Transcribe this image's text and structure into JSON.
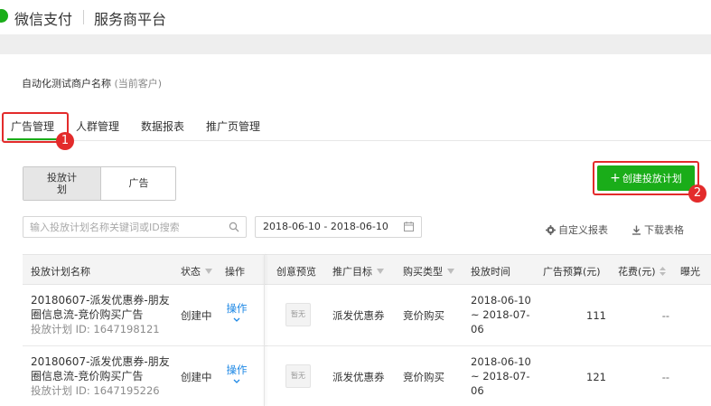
{
  "header": {
    "brand": "微信支付",
    "platform": "服务商平台"
  },
  "merchant": {
    "name": "自动化测试商户名称",
    "sub": "(当前客户)"
  },
  "tabs": [
    {
      "label": "广告管理",
      "active": true
    },
    {
      "label": "人群管理",
      "active": false
    },
    {
      "label": "数据报表",
      "active": false
    },
    {
      "label": "推广页管理",
      "active": false
    }
  ],
  "toggle": {
    "plan_line1": "投放计",
    "plan_line2": "划",
    "ad": "广告"
  },
  "create_button": {
    "label": "创建投放计划"
  },
  "callouts": {
    "one": "1",
    "two": "2"
  },
  "search": {
    "placeholder": "输入投放计划名称关键词或ID搜索"
  },
  "date_range": "2018-06-10 - 2018-06-10",
  "tools": {
    "custom_report": "自定义报表",
    "download": "下载表格"
  },
  "table": {
    "columns": {
      "name": "投放计划名称",
      "status": "状态",
      "op": "操作",
      "preview": "创意预览",
      "target": "推广目标",
      "buy_type": "购买类型",
      "time": "投放时间",
      "budget": "广告预算(元)",
      "spend": "花费(元)",
      "expo": "曝光"
    },
    "rows": [
      {
        "name_line1": "20180607-派发优惠券-朋友",
        "name_line2": "圈信息流-竞价购买广告",
        "plan_id": "投放计划 ID: 1647198121",
        "status": "创建中",
        "op": "操作",
        "preview": "暂无",
        "target": "派发优惠券",
        "buy_type": "竞价购买",
        "time_line1": "2018-06-10",
        "time_line2": "~ 2018-07-",
        "time_line3": "06",
        "budget": "111",
        "spend": "--"
      },
      {
        "name_line1": "20180607-派发优惠券-朋友",
        "name_line2": "圈信息流-竞价购买广告",
        "plan_id": "投放计划 ID: 1647195226",
        "status": "创建中",
        "op": "操作",
        "preview": "暂无",
        "target": "派发优惠券",
        "buy_type": "竞价购买",
        "time_line1": "2018-06-10",
        "time_line2": "~ 2018-07-",
        "time_line3": "06",
        "budget": "121",
        "spend": "--"
      }
    ]
  },
  "colors": {
    "brand_green": "#1aad19",
    "callout_red": "#e32b2b",
    "link_blue": "#1e88e5"
  }
}
